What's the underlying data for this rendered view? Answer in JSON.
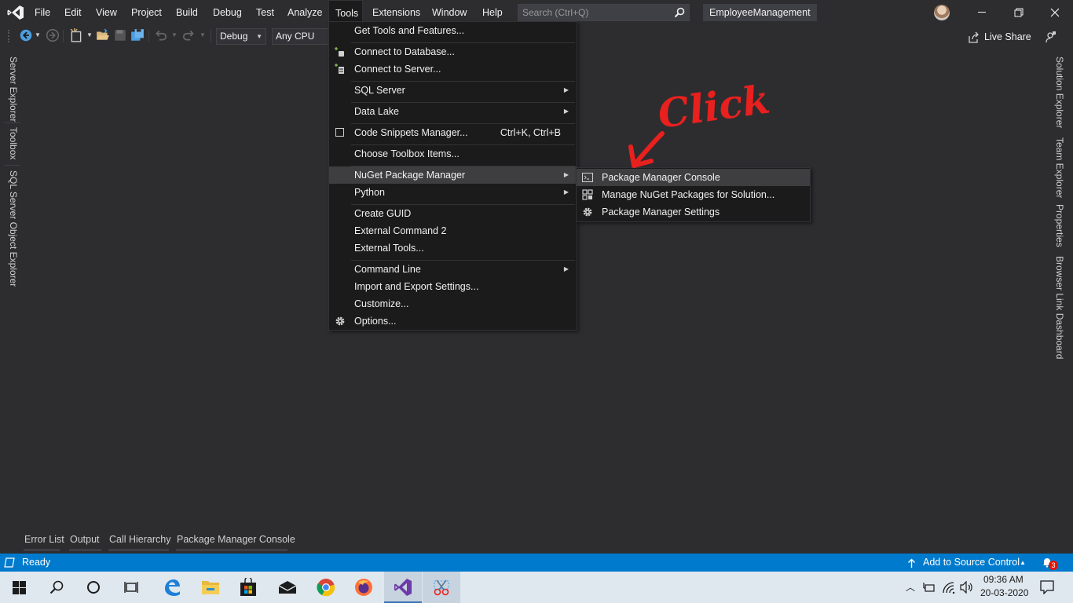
{
  "titlebar": {
    "menus": [
      "File",
      "Edit",
      "View",
      "Project",
      "Build",
      "Debug",
      "Test",
      "Analyze",
      "Tools",
      "Extensions",
      "Window",
      "Help"
    ],
    "search_placeholder": "Search (Ctrl+Q)",
    "solution_name": "EmployeeManagement"
  },
  "toolbar": {
    "config": "Debug",
    "platform": "Any CPU",
    "live_share": "Live Share"
  },
  "side_tabs": {
    "left": [
      "Server Explorer",
      "Toolbox",
      "SQL Server Object Explorer"
    ],
    "right": [
      "Solution Explorer",
      "Team Explorer",
      "Properties",
      "Browser Link Dashboard"
    ]
  },
  "tools_menu": {
    "items": [
      {
        "label": "Get Tools and Features..."
      },
      {
        "label": "Connect to Database..."
      },
      {
        "label": "Connect to Server..."
      },
      {
        "label": "SQL Server"
      },
      {
        "label": "Data Lake"
      },
      {
        "label": "Code Snippets Manager...",
        "shortcut": "Ctrl+K, Ctrl+B"
      },
      {
        "label": "Choose Toolbox Items..."
      },
      {
        "label": "NuGet Package Manager"
      },
      {
        "label": "Python"
      },
      {
        "label": "Create GUID"
      },
      {
        "label": "External Command 2"
      },
      {
        "label": "External Tools..."
      },
      {
        "label": "Command Line"
      },
      {
        "label": "Import and Export Settings..."
      },
      {
        "label": "Customize..."
      },
      {
        "label": "Options..."
      }
    ]
  },
  "nuget_submenu": {
    "items": [
      {
        "label": "Package Manager Console"
      },
      {
        "label": "Manage NuGet Packages for Solution..."
      },
      {
        "label": "Package Manager Settings"
      }
    ]
  },
  "annotation": {
    "text": "Click",
    "color": "#e8201e"
  },
  "bottom_tabs": [
    "Error List",
    "Output",
    "Call Hierarchy",
    "Package Manager Console"
  ],
  "statusbar": {
    "status": "Ready",
    "source_control": "Add to Source Control",
    "notification_count": "3",
    "color": "#007acc"
  },
  "taskbar": {
    "time": "09:36 AM",
    "date": "20-03-2020"
  }
}
